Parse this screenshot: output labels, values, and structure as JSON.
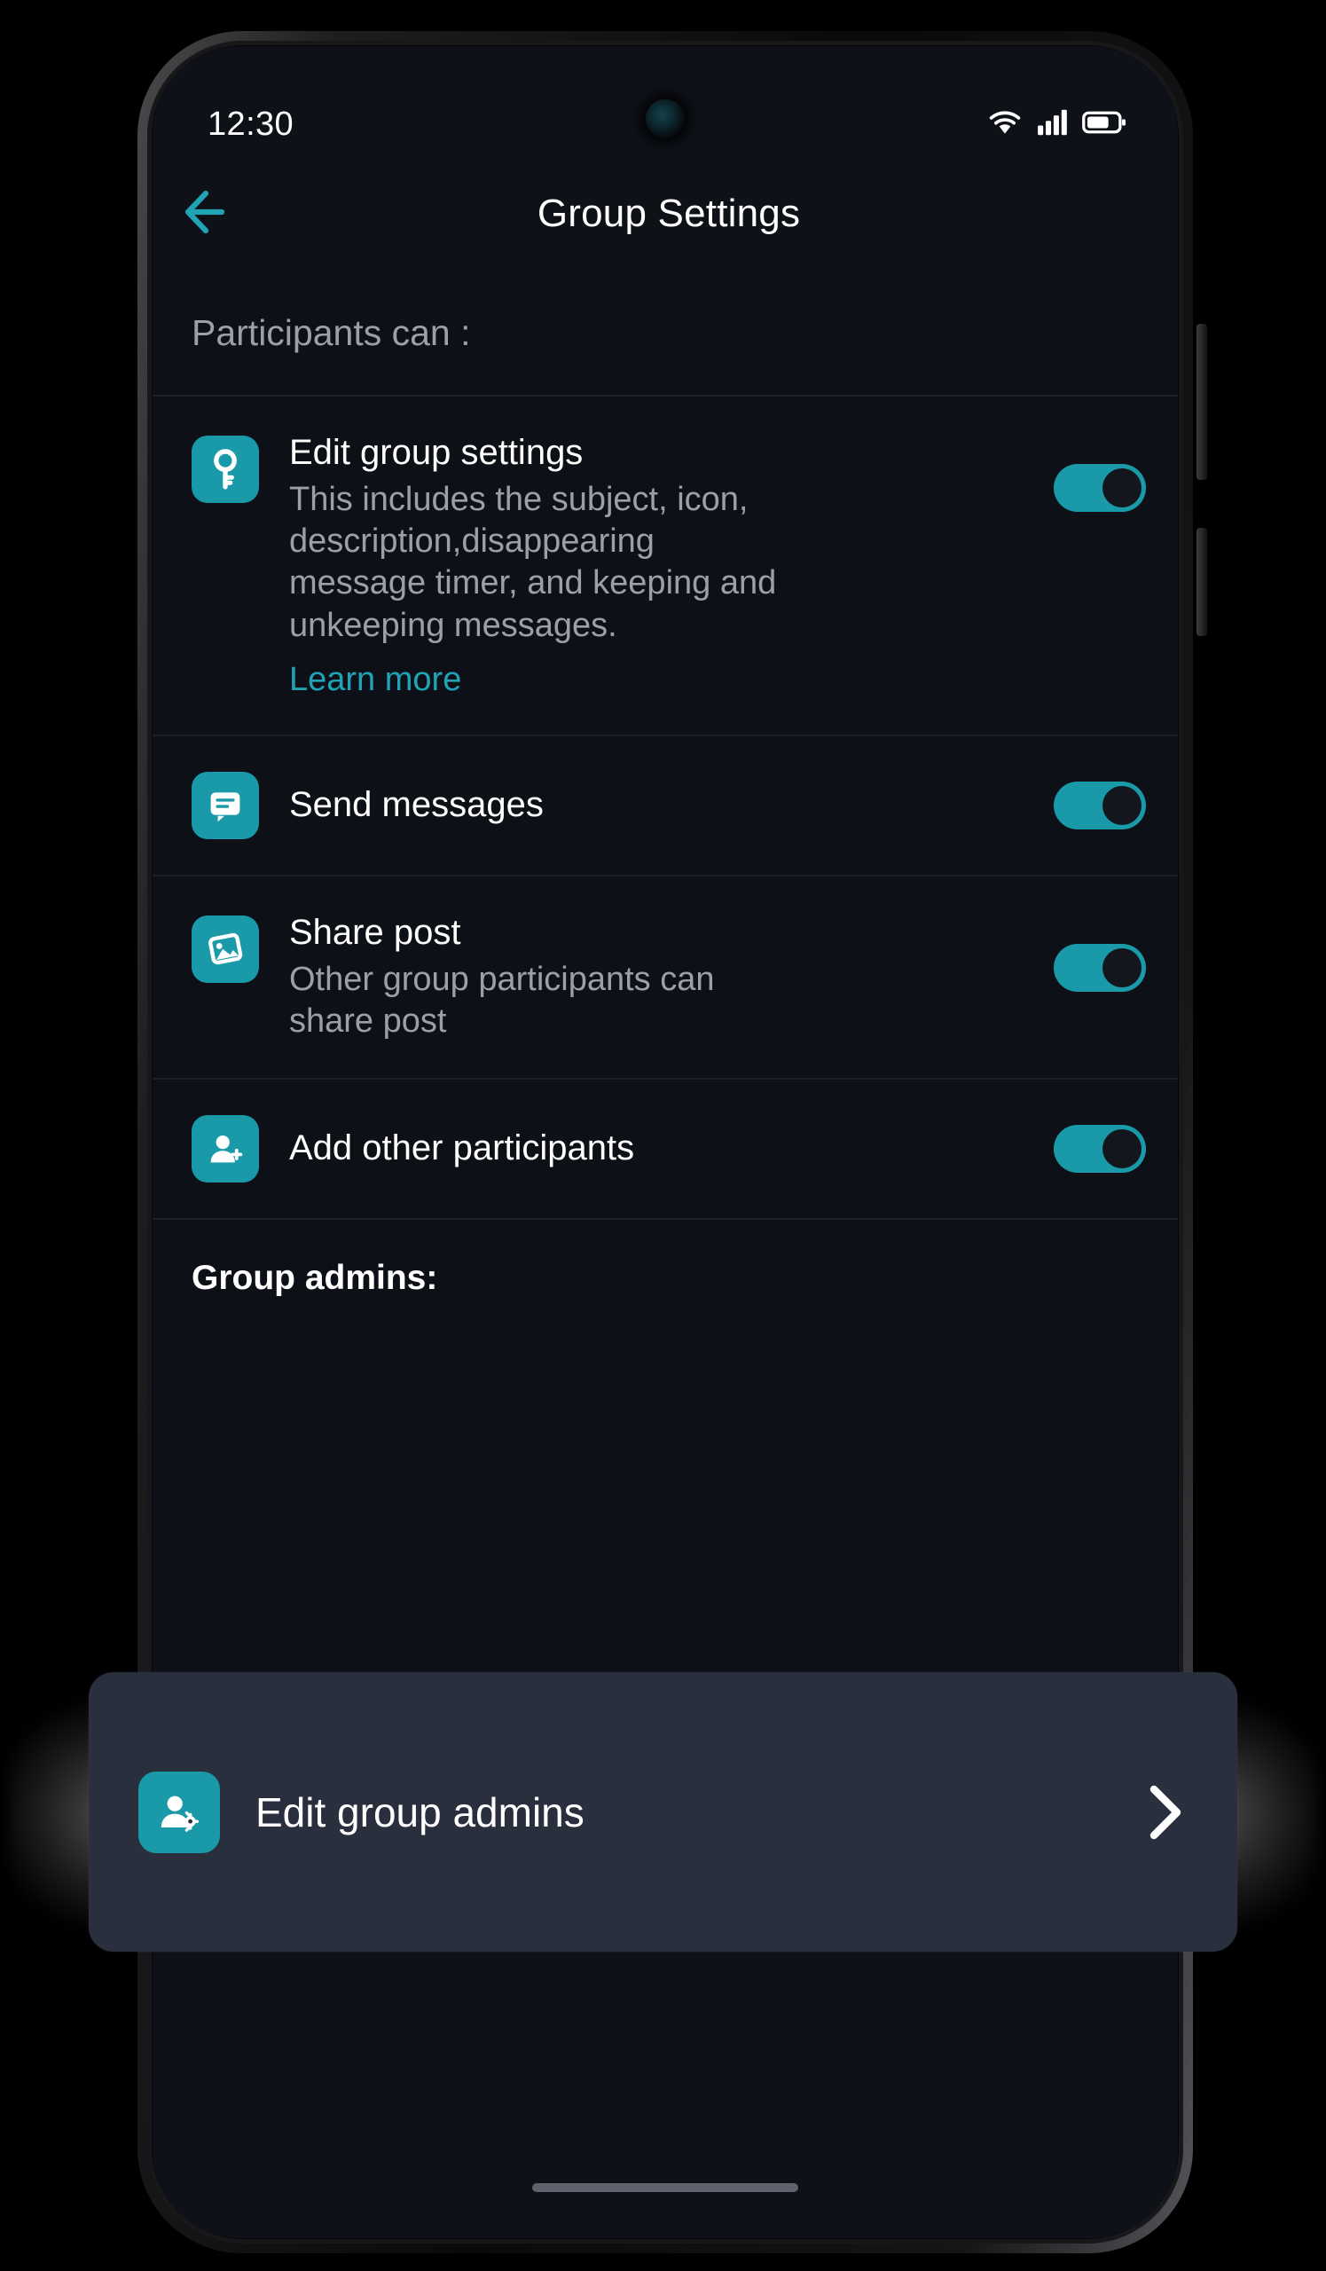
{
  "status_bar": {
    "time": "12:30",
    "icons": [
      "wifi-icon",
      "cellular-signal-icon",
      "battery-icon"
    ]
  },
  "app_bar": {
    "back_icon": "back-arrow-icon",
    "title": "Group Settings"
  },
  "sections": {
    "participants_header": "Participants can :",
    "admins_header": "Group admins:"
  },
  "rows": [
    {
      "icon": "key-icon",
      "title": "Edit group settings",
      "description": "This includes the subject, icon, description,disappearing message timer, and keeping and unkeeping messages.",
      "link": "Learn more",
      "toggle_on": true
    },
    {
      "icon": "message-icon",
      "title": "Send messages",
      "description": "",
      "link": "",
      "toggle_on": true
    },
    {
      "icon": "image-icon",
      "title": "Share post",
      "description": "Other group participants can share post",
      "link": "",
      "toggle_on": true
    },
    {
      "icon": "add-person-icon",
      "title": "Add other participants",
      "description": "",
      "link": "",
      "toggle_on": true
    }
  ],
  "admin_card": {
    "icon": "person-gear-icon",
    "label": "Edit group admins",
    "chevron_icon": "chevron-right-icon"
  },
  "colors": {
    "accent": "#1a9aa8",
    "link": "#1fa3b5",
    "screen_bg": "#0f1119",
    "row_bg": "#0e1018",
    "divider": "#1d2029",
    "title_text": "#ffffff",
    "secondary_text": "#9aa0a8",
    "card_bg": "#2a2f3d"
  }
}
